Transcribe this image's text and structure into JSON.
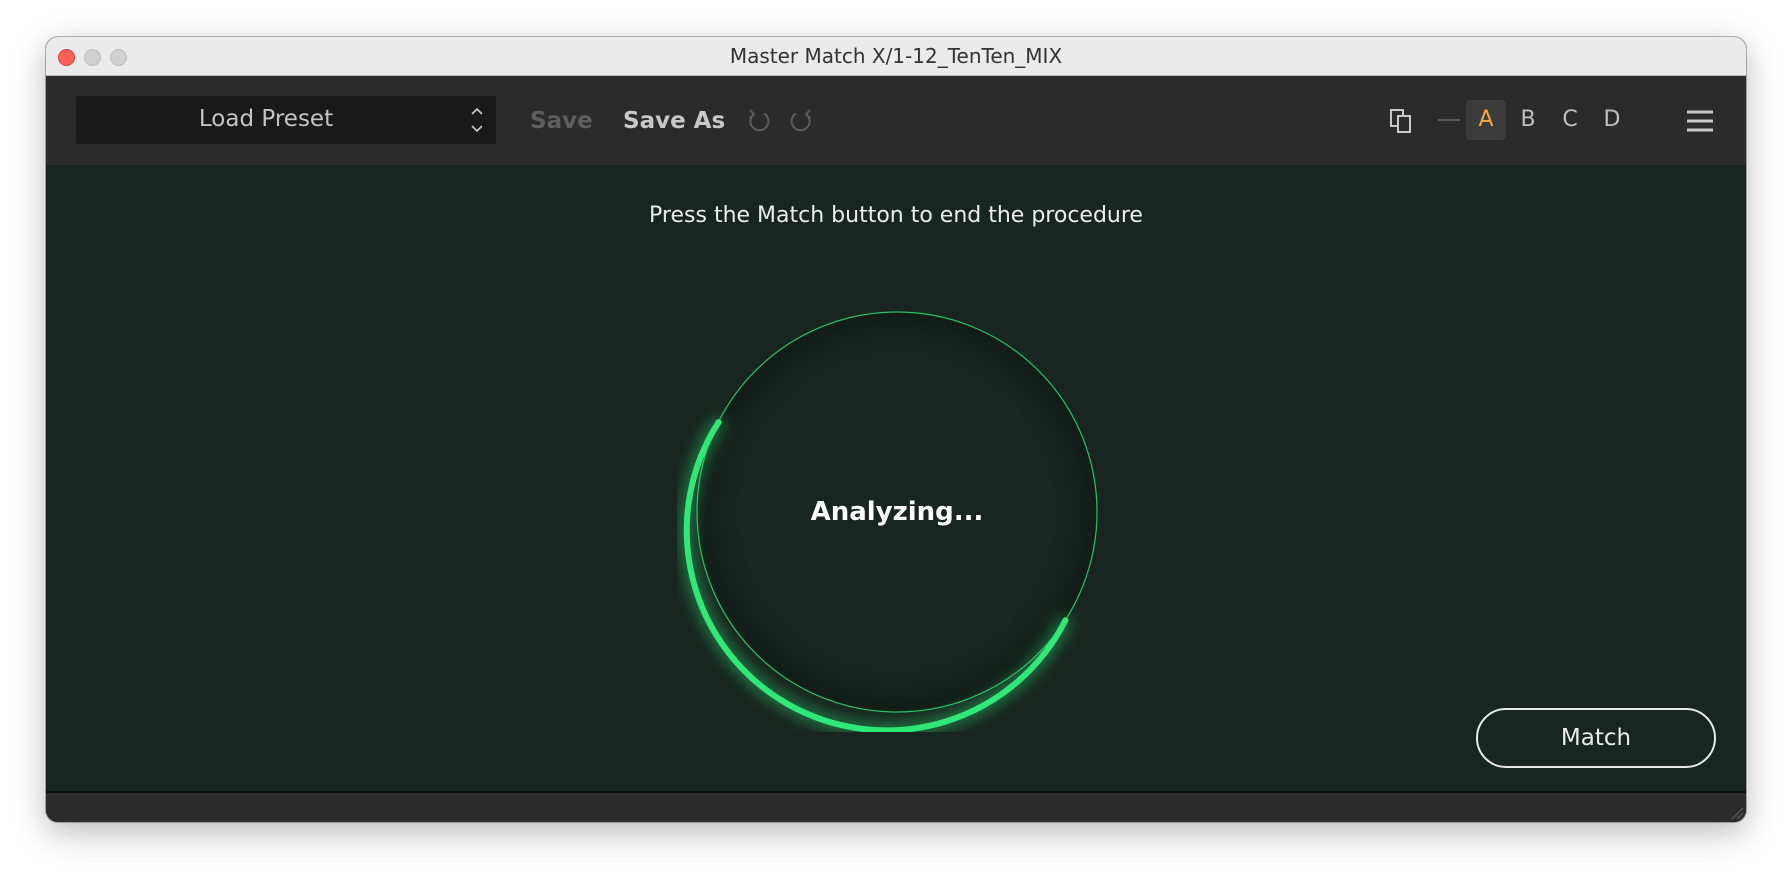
{
  "window": {
    "title": "Master Match X/1-12_TenTen_MIX"
  },
  "toolbar": {
    "preset_label": "Load Preset",
    "save_label": "Save",
    "save_as_label": "Save As",
    "slots": [
      "A",
      "B",
      "C",
      "D"
    ],
    "active_slot": "A"
  },
  "main": {
    "instruction": "Press the Match button to end the procedure",
    "status": "Analyzing...",
    "match_label": "Match"
  },
  "colors": {
    "accent_green": "#2ee878",
    "active_slot": "#f2a93b",
    "panel_bg": "#182520"
  },
  "icons": [
    "chevron-up-down-icon",
    "undo-icon",
    "redo-icon",
    "copy-icon",
    "dash-icon",
    "hamburger-menu-icon",
    "resize-grip-icon"
  ]
}
